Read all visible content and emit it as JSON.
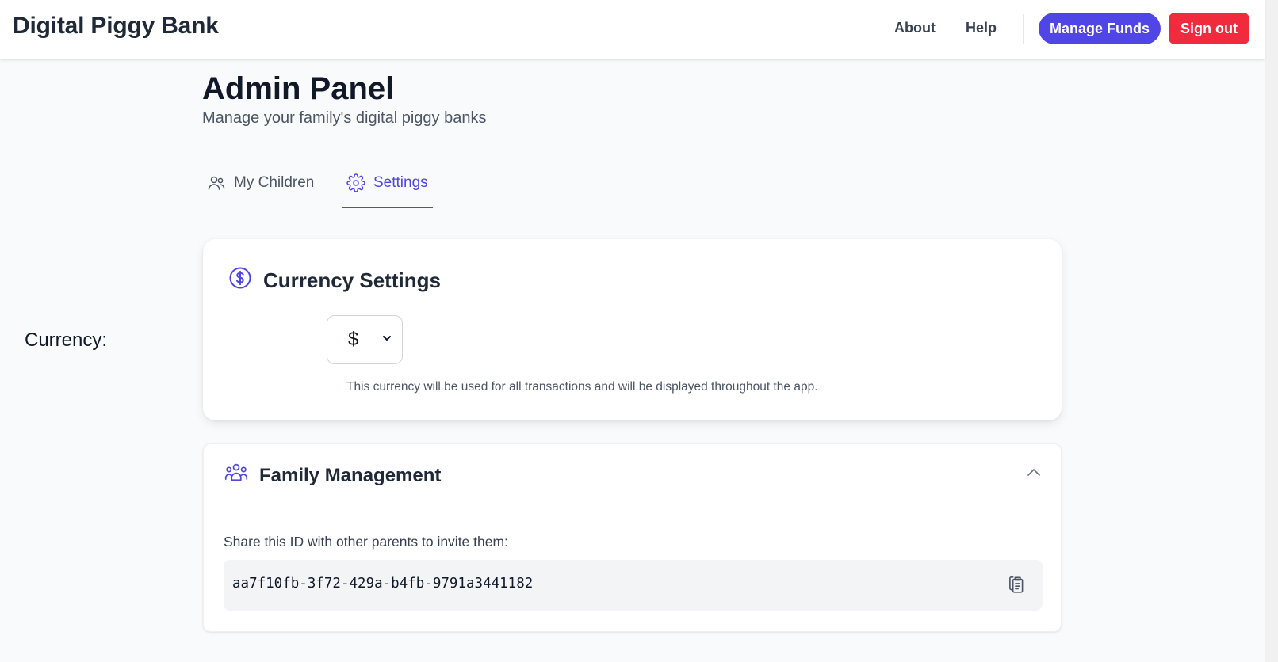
{
  "header": {
    "brand": "Digital Piggy Bank",
    "nav": {
      "about": "About",
      "help": "Help"
    },
    "manage_funds": "Manage Funds",
    "sign_out": "Sign out"
  },
  "page": {
    "title": "Admin Panel",
    "subtitle": "Manage your family's digital piggy banks"
  },
  "tabs": [
    {
      "label": "My Children",
      "icon": "users-icon",
      "active": false
    },
    {
      "label": "Settings",
      "icon": "gear-icon",
      "active": true
    }
  ],
  "currency_settings": {
    "heading": "Currency Settings",
    "icon": "dollar-circle-icon",
    "label": "Currency:",
    "selected": "$",
    "hint": "This currency will be used for all transactions and will be displayed throughout the app."
  },
  "family_management": {
    "heading": "Family Management",
    "icon": "family-icon",
    "share_label": "Share this ID with other parents to invite them:",
    "family_id": "aa7f10fb-3f72-429a-b4fb-9791a3441182",
    "expanded": true
  },
  "colors": {
    "accent": "#4f46e5",
    "danger": "#ef2b3d",
    "background": "#f9fafb"
  }
}
